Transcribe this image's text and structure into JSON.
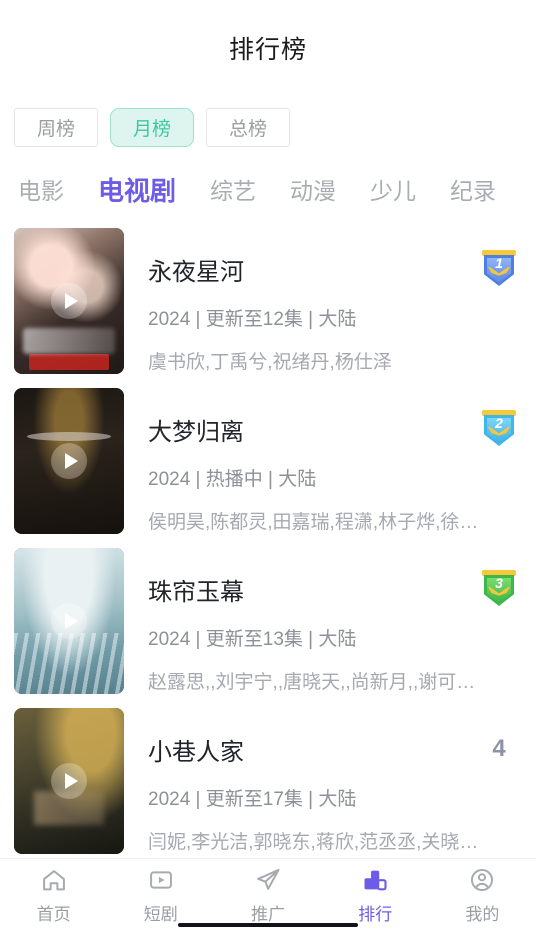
{
  "header": {
    "title": "排行榜"
  },
  "period_filter": {
    "options": [
      {
        "label": "周榜",
        "active": false
      },
      {
        "label": "月榜",
        "active": true
      },
      {
        "label": "总榜",
        "active": false
      }
    ],
    "active_color": "#3fc8a0",
    "active_bg": "#ddf5ee"
  },
  "category_tabs": {
    "active_color": "#6c5ce7",
    "items": [
      {
        "label": "电影",
        "active": false
      },
      {
        "label": "电视剧",
        "active": true
      },
      {
        "label": "综艺",
        "active": false
      },
      {
        "label": "动漫",
        "active": false
      },
      {
        "label": "少儿",
        "active": false
      },
      {
        "label": "纪录",
        "active": false
      }
    ]
  },
  "ranking_list": [
    {
      "rank": "1",
      "rank_style": "badge",
      "badge_color": "#4f7fe0",
      "title": "永夜星河",
      "meta": "2024 | 更新至12集 | 大陆",
      "cast": "虞书欣,丁禹兮,祝绪丹,杨仕泽"
    },
    {
      "rank": "2",
      "rank_style": "badge",
      "badge_color": "#3fb6e8",
      "title": "大梦归离",
      "meta": "2024 | 热播中 | 大陆",
      "cast": "侯明昊,陈都灵,田嘉瑞,程潇,林子烨,徐振轩,..."
    },
    {
      "rank": "3",
      "rank_style": "badge",
      "badge_color": "#3cb84a",
      "title": "珠帘玉幕",
      "meta": "2024 | 更新至13集 | 大陆",
      "cast": "赵露思,,刘宇宁,,唐晓天,,尚新月,,谢可寅,,唐..."
    },
    {
      "rank": "4",
      "rank_style": "number",
      "badge_color": "#8c93a6",
      "title": "小巷人家",
      "meta": "2024 | 更新至17集 | 大陆",
      "cast": "闫妮,李光洁,郭晓东,蒋欣,范丞丞,关晓彤,王..."
    }
  ],
  "tabbar": {
    "active_color": "#6c5ce7",
    "items": [
      {
        "label": "首页",
        "icon": "home-icon",
        "active": false
      },
      {
        "label": "短剧",
        "icon": "video-icon",
        "active": false
      },
      {
        "label": "推广",
        "icon": "paper-plane-icon",
        "active": false
      },
      {
        "label": "排行",
        "icon": "ranking-bars-icon",
        "active": true
      },
      {
        "label": "我的",
        "icon": "person-icon",
        "active": false
      }
    ]
  }
}
